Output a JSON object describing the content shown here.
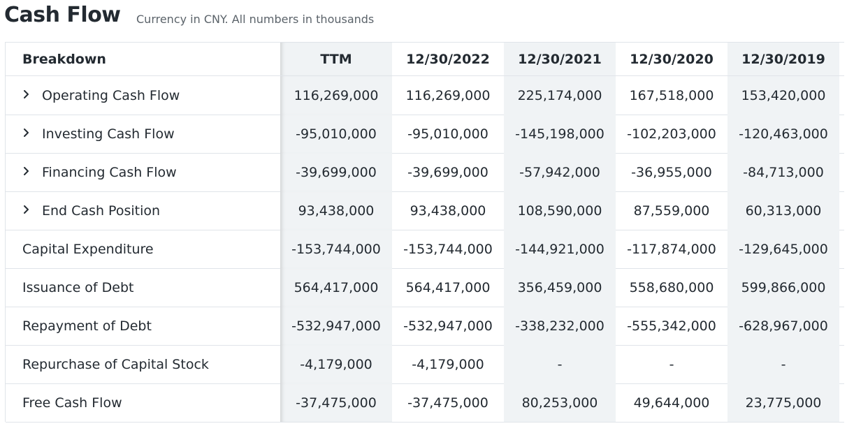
{
  "header": {
    "title": "Cash Flow",
    "subtitle": "Currency in CNY. All numbers in thousands"
  },
  "table": {
    "columns": [
      "Breakdown",
      "TTM",
      "12/30/2022",
      "12/30/2021",
      "12/30/2020",
      "12/30/2019"
    ],
    "rows": [
      {
        "label": "Operating Cash Flow",
        "expandable": true,
        "values": [
          "116,269,000",
          "116,269,000",
          "225,174,000",
          "167,518,000",
          "153,420,000"
        ]
      },
      {
        "label": "Investing Cash Flow",
        "expandable": true,
        "values": [
          "-95,010,000",
          "-95,010,000",
          "-145,198,000",
          "-102,203,000",
          "-120,463,000"
        ]
      },
      {
        "label": "Financing Cash Flow",
        "expandable": true,
        "values": [
          "-39,699,000",
          "-39,699,000",
          "-57,942,000",
          "-36,955,000",
          "-84,713,000"
        ]
      },
      {
        "label": "End Cash Position",
        "expandable": true,
        "values": [
          "93,438,000",
          "93,438,000",
          "108,590,000",
          "87,559,000",
          "60,313,000"
        ]
      },
      {
        "label": "Capital Expenditure",
        "expandable": false,
        "values": [
          "-153,744,000",
          "-153,744,000",
          "-144,921,000",
          "-117,874,000",
          "-129,645,000"
        ]
      },
      {
        "label": "Issuance of Debt",
        "expandable": false,
        "values": [
          "564,417,000",
          "564,417,000",
          "356,459,000",
          "558,680,000",
          "599,866,000"
        ]
      },
      {
        "label": "Repayment of Debt",
        "expandable": false,
        "values": [
          "-532,947,000",
          "-532,947,000",
          "-338,232,000",
          "-555,342,000",
          "-628,967,000"
        ]
      },
      {
        "label": "Repurchase of Capital Stock",
        "expandable": false,
        "values": [
          "-4,179,000",
          "-4,179,000",
          "-",
          "-",
          "-"
        ]
      },
      {
        "label": "Free Cash Flow",
        "expandable": false,
        "values": [
          "-37,475,000",
          "-37,475,000",
          "80,253,000",
          "49,644,000",
          "23,775,000"
        ]
      }
    ]
  },
  "icons": {
    "expand": "chevron-right-icon"
  }
}
